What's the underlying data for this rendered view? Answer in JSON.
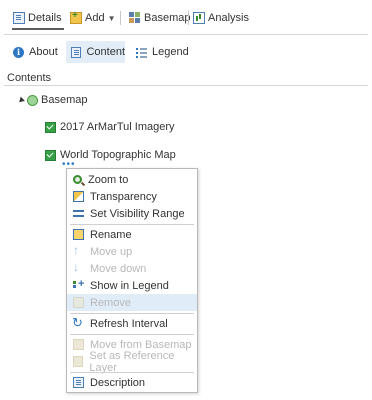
{
  "toolbar": {
    "details_label": "Details",
    "add_label": "Add",
    "basemap_label": "Basemap",
    "analysis_label": "Analysis"
  },
  "tabs": {
    "about_label": "About",
    "content_label": "Content",
    "legend_label": "Legend"
  },
  "contents_heading": "Contents",
  "tree": {
    "basemap_label": "Basemap",
    "layers": [
      {
        "label": "2017 ArMarTul Imagery"
      },
      {
        "label": "World Topographic Map"
      }
    ],
    "more_options": "•••"
  },
  "context_menu": {
    "items": [
      {
        "label": "Zoom to",
        "icon": "zoom-to-icon",
        "enabled": true
      },
      {
        "label": "Transparency",
        "icon": "transparency-icon",
        "enabled": true
      },
      {
        "label": "Set Visibility Range",
        "icon": "visibility-range-icon",
        "enabled": true
      },
      {
        "label": "Rename",
        "icon": "rename-icon",
        "enabled": true
      },
      {
        "label": "Move up",
        "icon": "move-up-icon",
        "enabled": false
      },
      {
        "label": "Move down",
        "icon": "move-down-icon",
        "enabled": false
      },
      {
        "label": "Show in Legend",
        "icon": "show-in-legend-icon",
        "enabled": true
      },
      {
        "label": "Remove",
        "icon": "remove-icon",
        "enabled": false,
        "hovered": true
      },
      {
        "label": "Refresh Interval",
        "icon": "refresh-icon",
        "enabled": true
      },
      {
        "label": "Move from Basemap",
        "icon": "move-from-basemap-icon",
        "enabled": false
      },
      {
        "label": "Set as Reference Layer",
        "icon": "reference-layer-icon",
        "enabled": false
      },
      {
        "label": "Description",
        "icon": "description-icon",
        "enabled": true
      }
    ]
  },
  "colors": {
    "selected_tab_bg": "#e2edf7",
    "menu_hover_bg": "#e0ecf8",
    "layer_checkbox": "#37a047",
    "disabled_text": "#b8b8b8"
  }
}
